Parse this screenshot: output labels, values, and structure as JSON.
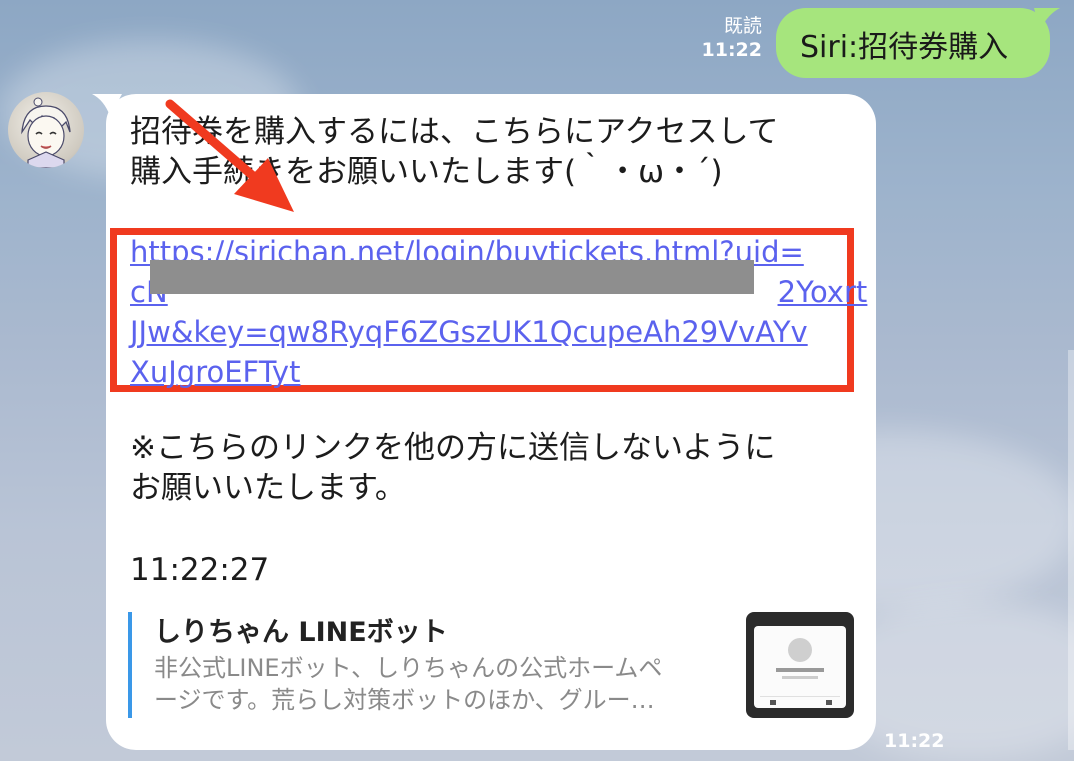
{
  "outgoing": {
    "read_label": "既読",
    "time": "11:22",
    "text": "Siri:招待券購入"
  },
  "incoming": {
    "avatar": "bot-avatar",
    "message_lines": [
      "招待券を購入するには、こちらにアクセスして",
      "購入手続きをお願いいたします(｀・ω・´)"
    ],
    "link_lines": [
      "https://sirichan.net/login/buytickets.html?uid=",
      "cN",
      "JJw&key=qw8RyqF6ZGszUK1QcupeAh29VvAYv",
      "XuJgroEFTyt"
    ],
    "link_line2_tail": "2Yoxrt",
    "warning_lines": [
      "※こちらのリンクを他の方に送信しないように",
      "お願いいたします。"
    ],
    "timestamp": "11:22:27",
    "preview": {
      "title": "しりちゃん LINEボット",
      "desc_lines": [
        "非公式LINEボット、しりちゃんの公式ホームペ",
        "ージです。荒らし対策ボットのほか、グルー…"
      ]
    },
    "time": "11:22"
  },
  "colors": {
    "outgoing_bubble": "#a6e57d",
    "link": "#5b62ee",
    "highlight": "#f03a1f",
    "preview_bar": "#3a98e8"
  }
}
